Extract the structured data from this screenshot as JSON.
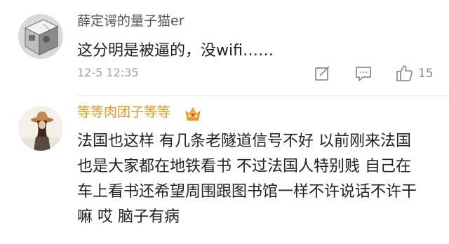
{
  "comments": [
    {
      "avatar_icon": "cat-avatar-icon",
      "username": "薛定谔的量子猫er",
      "text": "这分明是被逼的，没wifi……",
      "time": "12-5 12:35",
      "actions": {
        "share_icon": "share-icon",
        "reply_icon": "reply-icon",
        "like_icon": "thumbs-up-icon",
        "like_count": "15"
      }
    },
    {
      "avatar_icon": "user-avatar-icon",
      "username": "等等肉团子等等",
      "badge_icon": "crown-icon",
      "text_lines": [
        "法国也这样 有几条老隧道信号不好 以前刚来法国",
        "也是大家都在地铁看书 不过法国人特别贱 自己在",
        "车上看书还希望周围跟图书馆一样不许说话不许干",
        "嘛 哎 脑子有病"
      ]
    }
  ],
  "colors": {
    "vip_name": "#e3961f",
    "name": "#555555",
    "meta": "#a0a0a0",
    "text": "#222222"
  }
}
